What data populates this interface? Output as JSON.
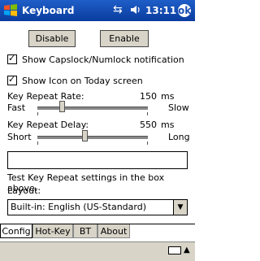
{
  "titlebar": {
    "title": "Keyboard",
    "time": "13:11",
    "ok_label": "ok"
  },
  "buttons": {
    "disable": "Disable",
    "enable": "Enable"
  },
  "checkboxes": [
    {
      "label": "Show Capslock/Numlock notification",
      "checked": true
    },
    {
      "label": "Show Icon on Today screen",
      "checked": true
    }
  ],
  "repeat_rate": {
    "label": "Key Repeat Rate:",
    "value": "150",
    "unit": "ms",
    "min_label": "Fast",
    "max_label": "Slow"
  },
  "repeat_delay": {
    "label": "Key Repeat Delay:",
    "value": "550",
    "unit": "ms",
    "min_label": "Short",
    "max_label": "Long"
  },
  "test_hint": "Test Key Repeat settings in the box above.",
  "layout": {
    "label": "Layout:",
    "selected": "Built-in: English (US-Standard)"
  },
  "tabs": [
    "Config",
    "Hot-Key",
    "BT",
    "About"
  ]
}
